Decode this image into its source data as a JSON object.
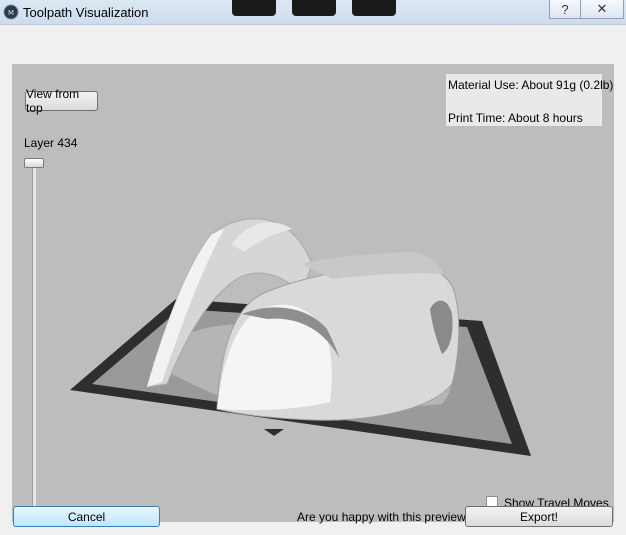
{
  "window": {
    "title": "Toolpath Visualization"
  },
  "titlebar": {
    "help_label": "?",
    "close_label": "✕"
  },
  "viewport": {
    "view_button_label": "View from top",
    "material_use": "Material Use: About 91g (0.2lb)",
    "print_time": "Print Time: About 8 hours",
    "layer_label": "Layer 434",
    "show_travel_label": "Show Travel Moves",
    "show_travel_checked": false
  },
  "footer": {
    "cancel_label": "Cancel",
    "question": "Are you happy with this preview?",
    "export_label": "Export!"
  },
  "icons": {
    "app": "app-logo-icon",
    "help": "help-icon",
    "close": "close-icon"
  }
}
